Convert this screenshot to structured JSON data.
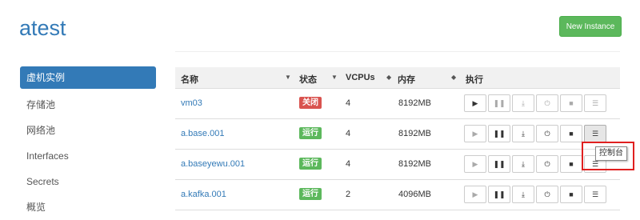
{
  "header": {
    "title": "atest",
    "new_instance_label": "New Instance"
  },
  "sidebar": {
    "items": [
      {
        "label": "虚机实例"
      },
      {
        "label": "存储池"
      },
      {
        "label": "网络池"
      },
      {
        "label": "Interfaces"
      },
      {
        "label": "Secrets"
      },
      {
        "label": "概览"
      }
    ]
  },
  "table": {
    "columns": [
      "名称",
      "状态",
      "VCPUs",
      "内存",
      "执行"
    ],
    "rows": [
      {
        "name": "vm03",
        "status": "关闭",
        "status_type": "off",
        "vcpus": "4",
        "memory": "8192MB"
      },
      {
        "name": "a.base.001",
        "status": "运行",
        "status_type": "on",
        "vcpus": "4",
        "memory": "8192MB"
      },
      {
        "name": "a.baseyewu.001",
        "status": "运行",
        "status_type": "on",
        "vcpus": "4",
        "memory": "8192MB"
      },
      {
        "name": "a.kafka.001",
        "status": "运行",
        "status_type": "on",
        "vcpus": "2",
        "memory": "4096MB"
      }
    ]
  },
  "tooltip": {
    "text": "控制台"
  },
  "colors": {
    "primary": "#337ab7",
    "success": "#5cb85c",
    "danger": "#d9534f",
    "highlight": "#e02020"
  },
  "icons": [
    "play-icon",
    "pause-icon",
    "download-icon",
    "power-icon",
    "stop-icon",
    "console-icon",
    "sort-icon"
  ]
}
